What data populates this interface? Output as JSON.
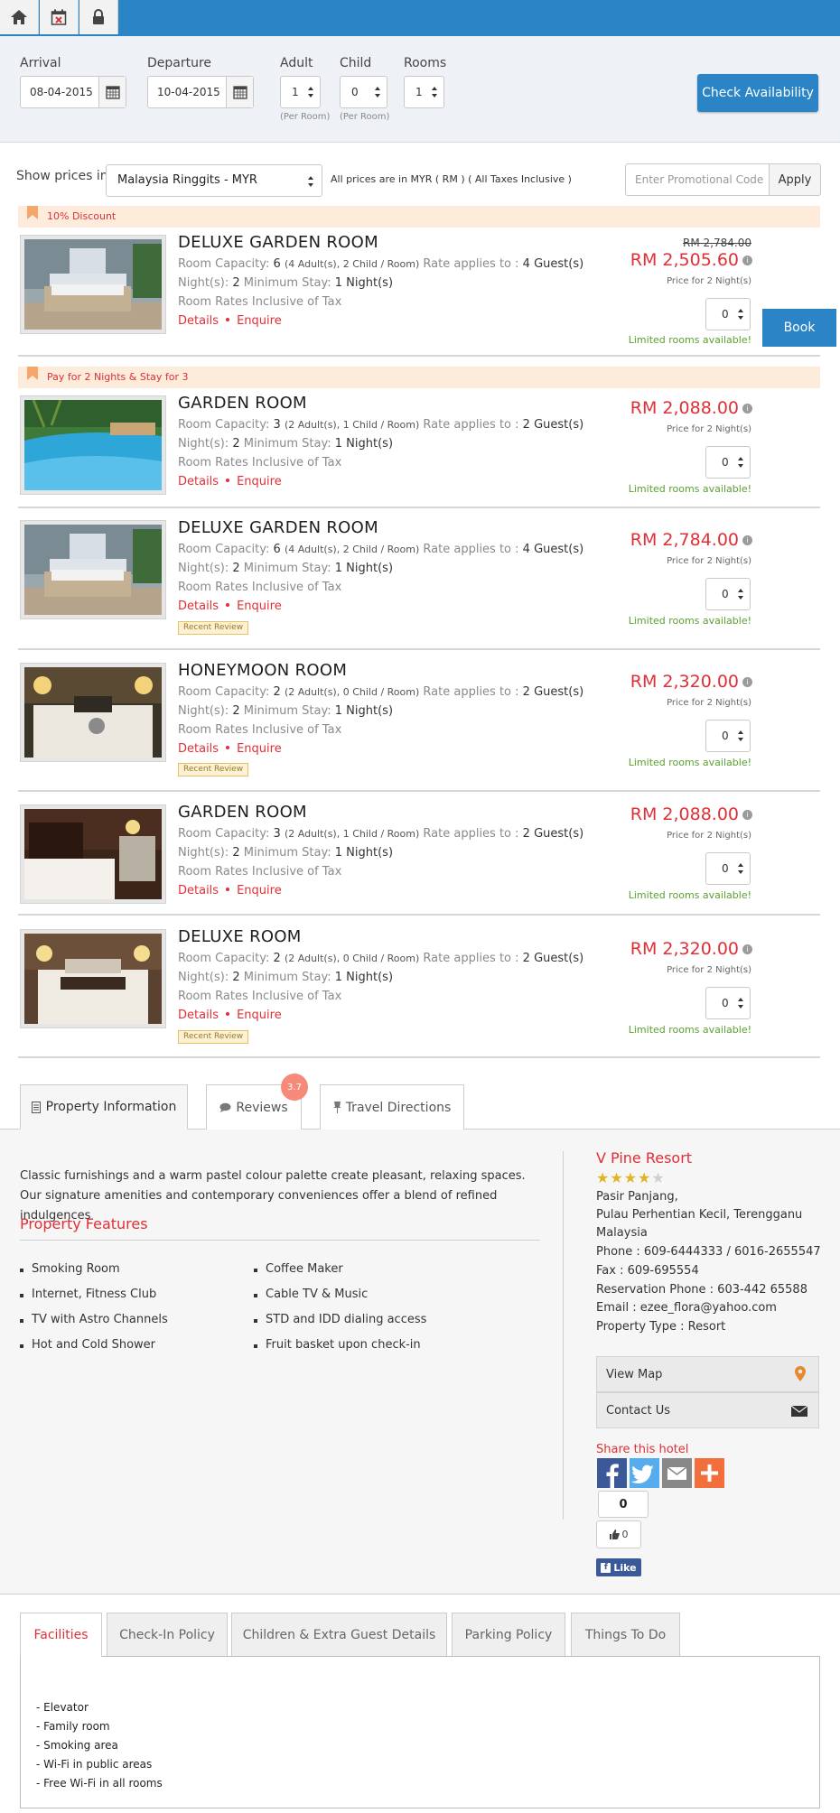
{
  "toolbar": {
    "icons": [
      "home-icon",
      "calendar-cancel-icon",
      "lock-icon"
    ]
  },
  "search": {
    "arrival_label": "Arrival",
    "arrival_value": "08-04-2015",
    "departure_label": "Departure",
    "departure_value": "10-04-2015",
    "adult_label": "Adult",
    "adult_value": "1",
    "adult_sub": "(Per Room)",
    "child_label": "Child",
    "child_value": "0",
    "child_sub": "(Per Room)",
    "rooms_label": "Rooms",
    "rooms_value": "1",
    "check_button": "Check Availability"
  },
  "currency": {
    "label": "Show prices in",
    "selected": "Malaysia Ringgits - MYR",
    "note": "All prices are in MYR ( RM ) ( All Taxes Inclusive )",
    "promo_placeholder": "Enter Promotional Code",
    "apply_button": "Apply"
  },
  "promos": [
    "10% Discount",
    "Pay for 2 Nights & Stay for 3"
  ],
  "rooms": [
    {
      "name": "DELUXE GARDEN ROOM",
      "cap_label": "Room Capacity:",
      "capacity": "6",
      "cap_detail": "(4 Adult(s), 2 Child / Room)",
      "rate_label": "Rate applies to :",
      "guests": "4 Guest(s)",
      "nights_label": "Night(s):",
      "nights": "2",
      "min_label": "Minimum Stay:",
      "min_stay": "1 Night(s)",
      "tax": "Room Rates Inclusive of Tax",
      "details": "Details",
      "enquire": "Enquire",
      "old_price": "RM 2,784.00",
      "price": "RM 2,505.60",
      "price_note": "Price for 2 Night(s)",
      "qty": "0",
      "limited": "Limited rooms available!"
    },
    {
      "name": "GARDEN ROOM",
      "cap_label": "Room Capacity:",
      "capacity": "3",
      "cap_detail": "(2 Adult(s), 1 Child / Room)",
      "rate_label": "Rate applies to :",
      "guests": "2 Guest(s)",
      "nights_label": "Night(s):",
      "nights": "2",
      "min_label": "Minimum Stay:",
      "min_stay": "1 Night(s)",
      "tax": "Room Rates Inclusive of Tax",
      "details": "Details",
      "enquire": "Enquire",
      "price": "RM 2,088.00",
      "price_note": "Price for 2 Night(s)",
      "qty": "0",
      "limited": "Limited rooms available!"
    },
    {
      "name": "DELUXE GARDEN ROOM",
      "cap_label": "Room Capacity:",
      "capacity": "6",
      "cap_detail": "(4 Adult(s), 2 Child / Room)",
      "rate_label": "Rate applies to :",
      "guests": "4 Guest(s)",
      "nights_label": "Night(s):",
      "nights": "2",
      "min_label": "Minimum Stay:",
      "min_stay": "1 Night(s)",
      "tax": "Room Rates Inclusive of Tax",
      "details": "Details",
      "enquire": "Enquire",
      "review": "Recent Review",
      "price": "RM 2,784.00",
      "price_note": "Price for 2 Night(s)",
      "qty": "0",
      "limited": "Limited rooms available!"
    },
    {
      "name": "HONEYMOON ROOM",
      "cap_label": "Room Capacity:",
      "capacity": "2",
      "cap_detail": "(2 Adult(s), 0 Child / Room)",
      "rate_label": "Rate applies to :",
      "guests": "2 Guest(s)",
      "nights_label": "Night(s):",
      "nights": "2",
      "min_label": "Minimum Stay:",
      "min_stay": "1 Night(s)",
      "tax": "Room Rates Inclusive of Tax",
      "details": "Details",
      "enquire": "Enquire",
      "review": "Recent Review",
      "price": "RM 2,320.00",
      "price_note": "Price for 2 Night(s)",
      "qty": "0",
      "limited": "Limited rooms available!"
    },
    {
      "name": "GARDEN ROOM",
      "cap_label": "Room Capacity:",
      "capacity": "3",
      "cap_detail": "(2 Adult(s), 1 Child / Room)",
      "rate_label": "Rate applies to :",
      "guests": "2 Guest(s)",
      "nights_label": "Night(s):",
      "nights": "2",
      "min_label": "Minimum Stay:",
      "min_stay": "1 Night(s)",
      "tax": "Room Rates Inclusive of Tax",
      "details": "Details",
      "enquire": "Enquire",
      "price": "RM 2,088.00",
      "price_note": "Price for 2 Night(s)",
      "qty": "0",
      "limited": "Limited rooms available!"
    },
    {
      "name": "DELUXE ROOM",
      "cap_label": "Room Capacity:",
      "capacity": "2",
      "cap_detail": "(2 Adult(s), 0 Child / Room)",
      "rate_label": "Rate applies to :",
      "guests": "2 Guest(s)",
      "nights_label": "Night(s):",
      "nights": "2",
      "min_label": "Minimum Stay:",
      "min_stay": "1 Night(s)",
      "tax": "Room Rates Inclusive of Tax",
      "details": "Details",
      "enquire": "Enquire",
      "review": "Recent Review",
      "price": "RM 2,320.00",
      "price_note": "Price for 2 Night(s)",
      "qty": "0",
      "limited": "Limited rooms available!"
    }
  ],
  "book_button": "Book",
  "tabs": {
    "property": "Property Information",
    "reviews": "Reviews",
    "reviews_rating": "3.7",
    "directions": "Travel Directions"
  },
  "property": {
    "description": "Classic furnishings and a warm pastel colour palette create pleasant, relaxing spaces. Our signature amenities and contemporary conveniences offer a blend of refined indulgences",
    "features_title": "Property Features",
    "features_left": [
      "Smoking Room",
      "Internet, Fitness Club",
      "TV with Astro Channels",
      "Hot and Cold Shower"
    ],
    "features_right": [
      "Coffee Maker",
      "Cable TV & Music",
      "STD and IDD dialing access",
      "Fruit basket upon check-in"
    ]
  },
  "hotel": {
    "name": "V Pine Resort",
    "stars": 4,
    "address_1": "Pasir Panjang,",
    "address_2": "Pulau Perhentian Kecil, Terengganu",
    "country": "Malaysia",
    "phone": "Phone : 609-6444333 / 6016-2655547",
    "fax": "Fax : 609-695554",
    "reservation": "Reservation Phone : 603-442 65588",
    "email": "Email : ezee_flora@yahoo.com",
    "type": "Property Type : Resort",
    "view_map": "View Map",
    "contact": "Contact Us",
    "share_title": "Share this hotel",
    "share_count": "0",
    "like_count": "0",
    "fb_like": "Like"
  },
  "bottom_tabs": [
    "Facilities",
    "Check-In Policy",
    "Children & Extra Guest Details",
    "Parking Policy",
    "Things To Do"
  ],
  "facilities": [
    "- Elevator",
    "- Family room",
    "- Smoking area",
    "- Wi-Fi in public areas",
    "- Free Wi-Fi in all rooms"
  ],
  "colors": {
    "brand_blue": "#2a84c6",
    "price_red": "#e02f36",
    "available_green": "#5ba12f",
    "promo_bg": "#fdebdb"
  }
}
